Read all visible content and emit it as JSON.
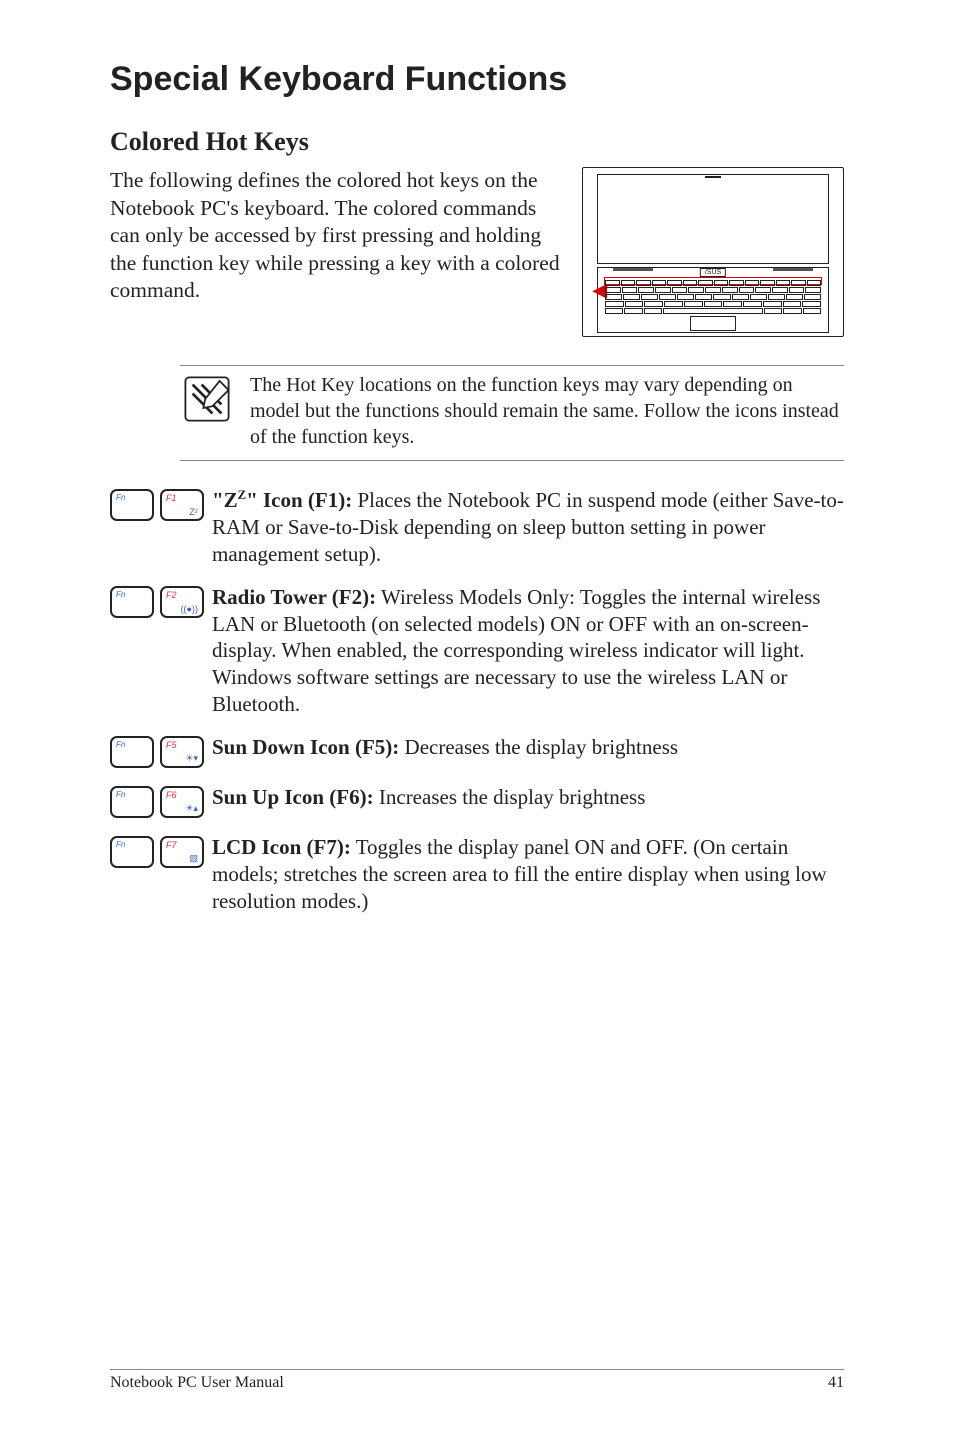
{
  "title": "Special Keyboard Functions",
  "section_heading": "Colored Hot Keys",
  "intro": "The following defines the colored hot keys on the Notebook PC's keyboard. The colored commands can only be accessed by first pressing and holding the function key while pressing a key with a colored command.",
  "note": "The Hot Key locations on the function keys may vary depending on model but the functions should remain the same. Follow the icons instead of the function keys.",
  "laptop_brand": "/SUS",
  "fn_label": "Fn",
  "rows": [
    {
      "key_tl": "F1",
      "key_br": "Zᶻ",
      "title_html": "\"Z<sup>Z</sup>\" Icon (F1):",
      "body": " Places the Notebook PC in suspend mode (either Save-to-RAM or Save-to-Disk depending on sleep button setting in power management setup)."
    },
    {
      "key_tl": "F2",
      "key_br": "((●))",
      "title_html": "Radio Tower (F2):",
      "body": " Wireless Models Only: Toggles the internal wireless LAN or Bluetooth (on selected models) ON or OFF with an on-screen-display. When enabled, the corresponding wireless indicator will light. Windows software settings are necessary to use the wireless LAN or Bluetooth."
    },
    {
      "key_tl": "F5",
      "key_br": "☀▾",
      "title_html": "Sun Down Icon (F5):",
      "body": " Decreases the display brightness"
    },
    {
      "key_tl": "F6",
      "key_br": "☀▴",
      "title_html": "Sun Up Icon (F6):",
      "body": " Increases the display brightness"
    },
    {
      "key_tl": "F7",
      "key_br": "▧",
      "title_html": "LCD Icon (F7):",
      "body": " Toggles the display panel ON and OFF. (On certain models; stretches the screen area to fill the entire display when using low resolution modes.)"
    }
  ],
  "footer_left": "Notebook PC User Manual",
  "footer_right": "41"
}
